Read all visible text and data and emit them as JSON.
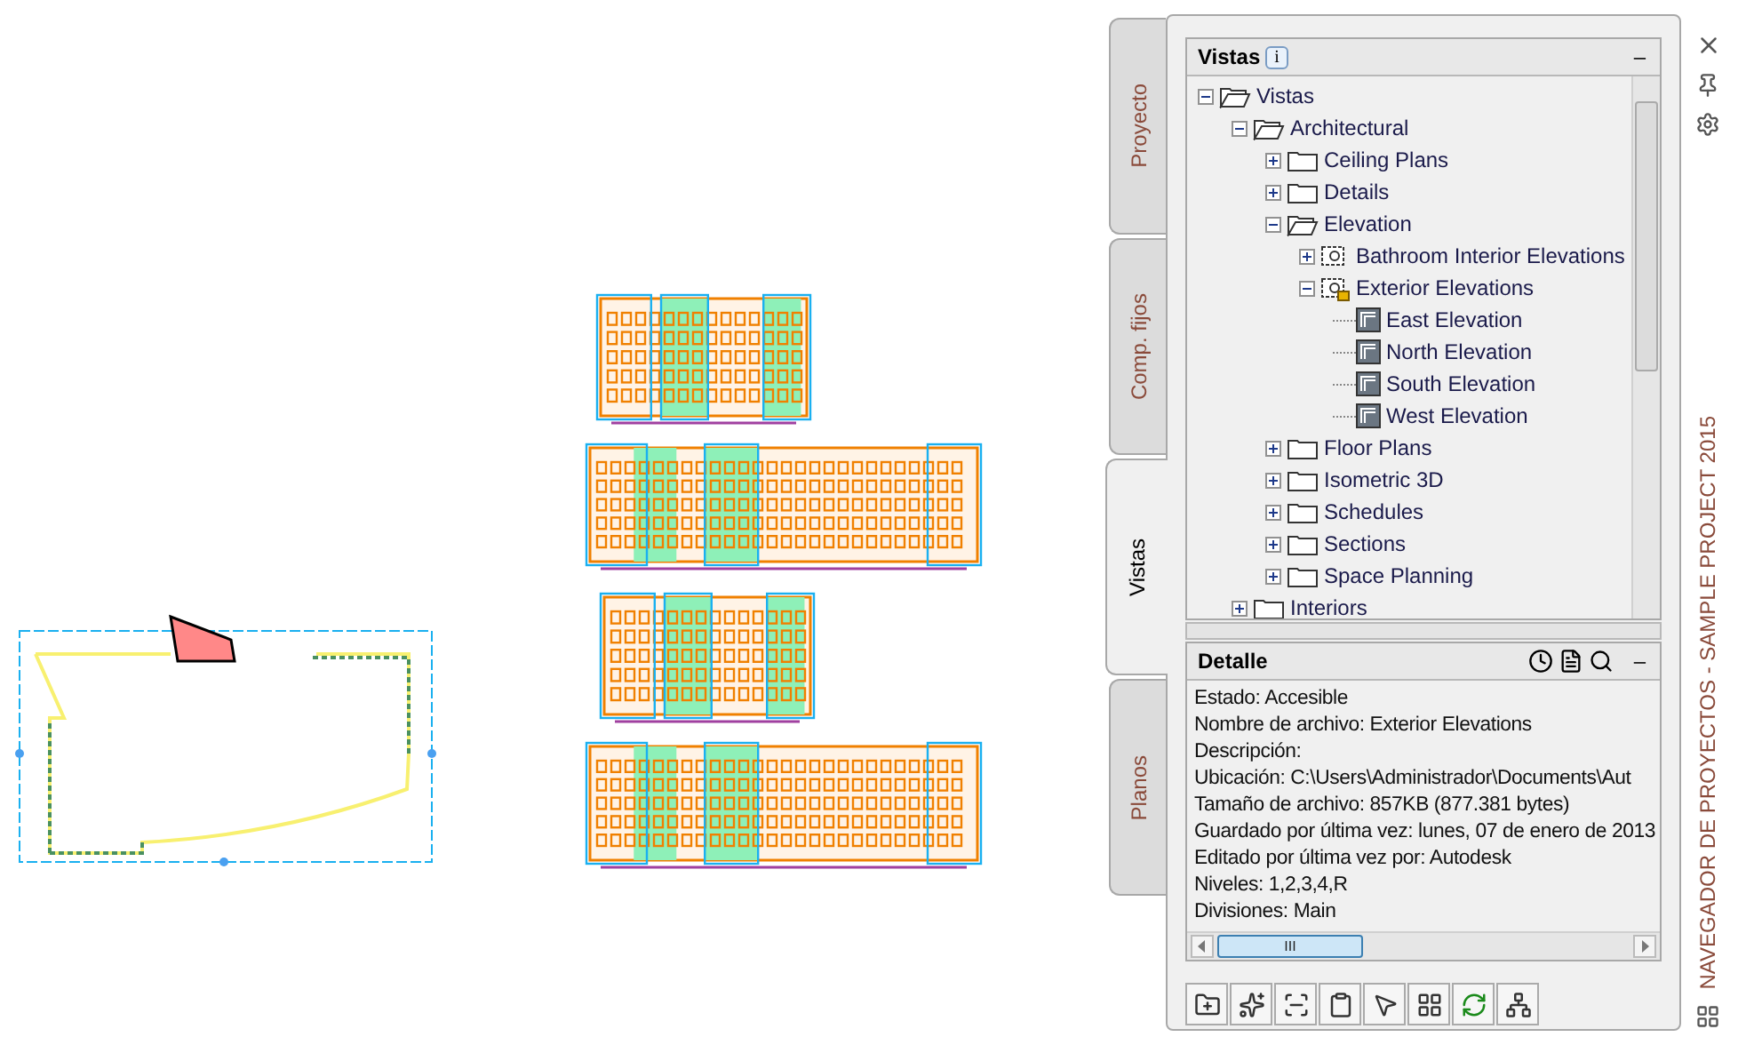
{
  "palette": {
    "title": "NAVEGADOR DE PROYECTOS - SAMPLE PROJECT 2015"
  },
  "tabs": [
    {
      "label": "Proyecto",
      "selected": false
    },
    {
      "label": "Comp. fijos",
      "selected": false
    },
    {
      "label": "Vistas",
      "selected": true
    },
    {
      "label": "Planos",
      "selected": false
    }
  ],
  "views_panel": {
    "title": "Vistas",
    "info_badge": "i",
    "collapse": "–",
    "tree": [
      {
        "label": "Vistas",
        "kind": "folder",
        "expanded": true,
        "children": [
          {
            "label": "Architectural",
            "kind": "folder",
            "expanded": true,
            "children": [
              {
                "label": "Ceiling Plans",
                "kind": "folder",
                "expanded": false
              },
              {
                "label": "Details",
                "kind": "folder",
                "expanded": false
              },
              {
                "label": "Elevation",
                "kind": "folder",
                "expanded": true,
                "children": [
                  {
                    "label": "Bathroom Interior Elevations",
                    "kind": "category",
                    "expanded": false,
                    "locked": false
                  },
                  {
                    "label": "Exterior Elevations",
                    "kind": "category",
                    "expanded": true,
                    "locked": true,
                    "children": [
                      {
                        "label": "East Elevation",
                        "kind": "view"
                      },
                      {
                        "label": "North Elevation",
                        "kind": "view"
                      },
                      {
                        "label": "South Elevation",
                        "kind": "view"
                      },
                      {
                        "label": "West Elevation",
                        "kind": "view"
                      }
                    ]
                  }
                ]
              },
              {
                "label": "Floor Plans",
                "kind": "folder",
                "expanded": false
              },
              {
                "label": "Isometric 3D",
                "kind": "folder",
                "expanded": false
              },
              {
                "label": "Schedules",
                "kind": "folder",
                "expanded": false
              },
              {
                "label": "Sections",
                "kind": "folder",
                "expanded": false
              },
              {
                "label": "Space Planning",
                "kind": "folder",
                "expanded": false
              }
            ]
          },
          {
            "label": "Interiors",
            "kind": "folder",
            "expanded": false
          }
        ]
      }
    ]
  },
  "detail_panel": {
    "title": "Detalle",
    "collapse": "–",
    "lines": [
      "Estado: Accesible",
      "Nombre de archivo: Exterior Elevations",
      "Descripción:",
      "Ubicación: C:\\Users\\Administrador\\Documents\\Aut",
      "Tamaño de archivo: 857KB (877.381 bytes)",
      "Guardado por última vez: lunes, 07 de enero de 2013",
      "Editado por última vez por: Autodesk",
      "Niveles: 1,2,3,4,R",
      "Divisiones: Main"
    ],
    "scroll_grip": "III"
  }
}
